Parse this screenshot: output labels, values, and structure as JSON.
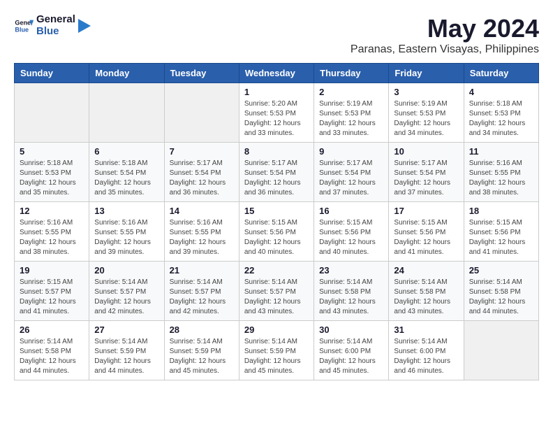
{
  "logo": {
    "text_general": "General",
    "text_blue": "Blue"
  },
  "title": "May 2024",
  "subtitle": "Paranas, Eastern Visayas, Philippines",
  "days_header": [
    "Sunday",
    "Monday",
    "Tuesday",
    "Wednesday",
    "Thursday",
    "Friday",
    "Saturday"
  ],
  "weeks": [
    [
      {
        "day": "",
        "info": ""
      },
      {
        "day": "",
        "info": ""
      },
      {
        "day": "",
        "info": ""
      },
      {
        "day": "1",
        "info": "Sunrise: 5:20 AM\nSunset: 5:53 PM\nDaylight: 12 hours\nand 33 minutes."
      },
      {
        "day": "2",
        "info": "Sunrise: 5:19 AM\nSunset: 5:53 PM\nDaylight: 12 hours\nand 33 minutes."
      },
      {
        "day": "3",
        "info": "Sunrise: 5:19 AM\nSunset: 5:53 PM\nDaylight: 12 hours\nand 34 minutes."
      },
      {
        "day": "4",
        "info": "Sunrise: 5:18 AM\nSunset: 5:53 PM\nDaylight: 12 hours\nand 34 minutes."
      }
    ],
    [
      {
        "day": "5",
        "info": "Sunrise: 5:18 AM\nSunset: 5:53 PM\nDaylight: 12 hours\nand 35 minutes."
      },
      {
        "day": "6",
        "info": "Sunrise: 5:18 AM\nSunset: 5:54 PM\nDaylight: 12 hours\nand 35 minutes."
      },
      {
        "day": "7",
        "info": "Sunrise: 5:17 AM\nSunset: 5:54 PM\nDaylight: 12 hours\nand 36 minutes."
      },
      {
        "day": "8",
        "info": "Sunrise: 5:17 AM\nSunset: 5:54 PM\nDaylight: 12 hours\nand 36 minutes."
      },
      {
        "day": "9",
        "info": "Sunrise: 5:17 AM\nSunset: 5:54 PM\nDaylight: 12 hours\nand 37 minutes."
      },
      {
        "day": "10",
        "info": "Sunrise: 5:17 AM\nSunset: 5:54 PM\nDaylight: 12 hours\nand 37 minutes."
      },
      {
        "day": "11",
        "info": "Sunrise: 5:16 AM\nSunset: 5:55 PM\nDaylight: 12 hours\nand 38 minutes."
      }
    ],
    [
      {
        "day": "12",
        "info": "Sunrise: 5:16 AM\nSunset: 5:55 PM\nDaylight: 12 hours\nand 38 minutes."
      },
      {
        "day": "13",
        "info": "Sunrise: 5:16 AM\nSunset: 5:55 PM\nDaylight: 12 hours\nand 39 minutes."
      },
      {
        "day": "14",
        "info": "Sunrise: 5:16 AM\nSunset: 5:55 PM\nDaylight: 12 hours\nand 39 minutes."
      },
      {
        "day": "15",
        "info": "Sunrise: 5:15 AM\nSunset: 5:56 PM\nDaylight: 12 hours\nand 40 minutes."
      },
      {
        "day": "16",
        "info": "Sunrise: 5:15 AM\nSunset: 5:56 PM\nDaylight: 12 hours\nand 40 minutes."
      },
      {
        "day": "17",
        "info": "Sunrise: 5:15 AM\nSunset: 5:56 PM\nDaylight: 12 hours\nand 41 minutes."
      },
      {
        "day": "18",
        "info": "Sunrise: 5:15 AM\nSunset: 5:56 PM\nDaylight: 12 hours\nand 41 minutes."
      }
    ],
    [
      {
        "day": "19",
        "info": "Sunrise: 5:15 AM\nSunset: 5:57 PM\nDaylight: 12 hours\nand 41 minutes."
      },
      {
        "day": "20",
        "info": "Sunrise: 5:14 AM\nSunset: 5:57 PM\nDaylight: 12 hours\nand 42 minutes."
      },
      {
        "day": "21",
        "info": "Sunrise: 5:14 AM\nSunset: 5:57 PM\nDaylight: 12 hours\nand 42 minutes."
      },
      {
        "day": "22",
        "info": "Sunrise: 5:14 AM\nSunset: 5:57 PM\nDaylight: 12 hours\nand 43 minutes."
      },
      {
        "day": "23",
        "info": "Sunrise: 5:14 AM\nSunset: 5:58 PM\nDaylight: 12 hours\nand 43 minutes."
      },
      {
        "day": "24",
        "info": "Sunrise: 5:14 AM\nSunset: 5:58 PM\nDaylight: 12 hours\nand 43 minutes."
      },
      {
        "day": "25",
        "info": "Sunrise: 5:14 AM\nSunset: 5:58 PM\nDaylight: 12 hours\nand 44 minutes."
      }
    ],
    [
      {
        "day": "26",
        "info": "Sunrise: 5:14 AM\nSunset: 5:58 PM\nDaylight: 12 hours\nand 44 minutes."
      },
      {
        "day": "27",
        "info": "Sunrise: 5:14 AM\nSunset: 5:59 PM\nDaylight: 12 hours\nand 44 minutes."
      },
      {
        "day": "28",
        "info": "Sunrise: 5:14 AM\nSunset: 5:59 PM\nDaylight: 12 hours\nand 45 minutes."
      },
      {
        "day": "29",
        "info": "Sunrise: 5:14 AM\nSunset: 5:59 PM\nDaylight: 12 hours\nand 45 minutes."
      },
      {
        "day": "30",
        "info": "Sunrise: 5:14 AM\nSunset: 6:00 PM\nDaylight: 12 hours\nand 45 minutes."
      },
      {
        "day": "31",
        "info": "Sunrise: 5:14 AM\nSunset: 6:00 PM\nDaylight: 12 hours\nand 46 minutes."
      },
      {
        "day": "",
        "info": ""
      }
    ]
  ]
}
